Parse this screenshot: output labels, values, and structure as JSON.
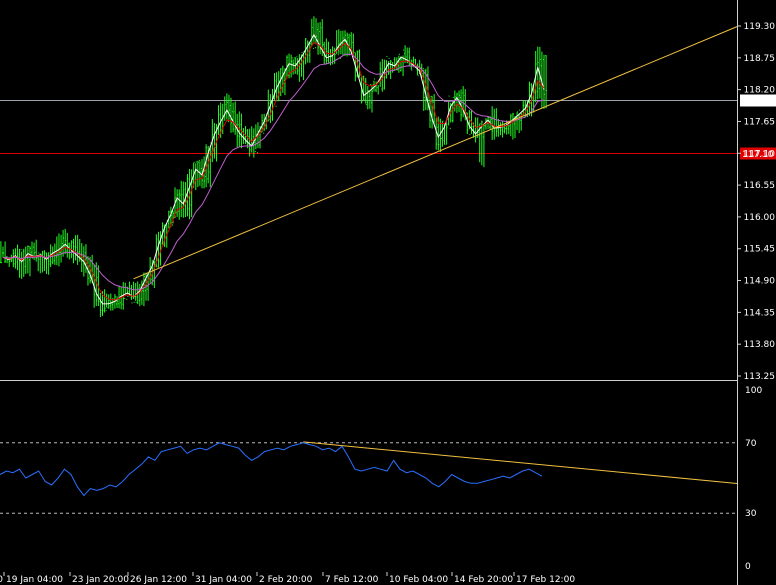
{
  "chart_data": [
    {
      "type": "candlestick",
      "symbol": "",
      "y_ticks": [
        "119.30",
        "118.75",
        "118.20",
        "117.65",
        "117.10",
        "116.55",
        "116.00",
        "115.45",
        "114.90",
        "114.35",
        "113.80",
        "113.25"
      ],
      "ylim": [
        113.25,
        119.3
      ],
      "x_ticks": [
        "19 Jan 04:00",
        "23 Jan 20:00",
        "26 Jan 12:00",
        "31 Jan 04:00",
        "2 Feb 20:00",
        "7 Feb 12:00",
        "10 Feb 04:00",
        "14 Feb 20:00",
        "17 Feb 12:00"
      ],
      "x_left_cut_label": "0",
      "price": {
        "close": [
          115.3,
          115.25,
          115.35,
          115.2,
          115.4,
          115.3,
          115.35,
          115.25,
          115.4,
          115.45,
          115.55,
          115.4,
          115.3,
          115.2,
          114.95,
          114.6,
          114.45,
          114.5,
          114.55,
          114.65,
          114.7,
          114.6,
          114.75,
          115.0,
          115.2,
          115.6,
          115.9,
          116.1,
          116.4,
          116.2,
          116.6,
          116.9,
          116.7,
          117.2,
          117.5,
          117.7,
          117.9,
          117.6,
          117.4,
          117.3,
          117.2,
          117.5,
          117.7,
          118.0,
          118.3,
          118.5,
          118.7,
          118.6,
          118.8,
          119.0,
          119.2,
          118.9,
          118.7,
          118.8,
          119.0,
          119.1,
          118.8,
          118.4,
          118.0,
          118.2,
          118.3,
          118.5,
          118.7,
          118.6,
          118.8,
          118.7,
          118.6,
          118.5,
          118.0,
          117.6,
          117.3,
          117.6,
          118.0,
          118.1,
          117.8,
          117.5,
          117.4,
          117.6,
          117.7,
          117.5,
          117.55,
          117.6,
          117.7,
          117.8,
          117.9,
          118.2,
          118.7,
          118.1
        ],
        "high_points": [
          119.5,
          118.9,
          116.8
        ],
        "low_points": [
          114.25,
          116.8
        ]
      },
      "moving_averages": [
        {
          "color": "#e00000",
          "kind": "fast"
        },
        {
          "color": "#c060d0",
          "kind": "slow"
        }
      ],
      "horizontal_lines": [
        {
          "value": 118.02,
          "color": "#9aa0a6",
          "label": "118.02"
        },
        {
          "value": 117.1,
          "color": "#e00000",
          "label": "117.10"
        }
      ],
      "trendline": {
        "color": "#f0c040",
        "points": [
          [
            21,
            114.93
          ],
          [
            86,
            117.85
          ]
        ]
      }
    },
    {
      "type": "line",
      "indicator": "oscillator",
      "y_ticks": [
        "100",
        "70",
        "30",
        "0"
      ],
      "ylim": [
        0,
        100
      ],
      "levels": [
        70,
        30
      ],
      "series": [
        {
          "color": "#2a6fff",
          "values": [
            52,
            54,
            53,
            55,
            50,
            52,
            54,
            48,
            46,
            50,
            55,
            52,
            45,
            40,
            44,
            43,
            44,
            46,
            45,
            48,
            52,
            55,
            58,
            62,
            60,
            65,
            66,
            67,
            68,
            64,
            66,
            67,
            66,
            68,
            70,
            69,
            68,
            67,
            63,
            60,
            62,
            65,
            66,
            67,
            66,
            68,
            69,
            70,
            69,
            68,
            66,
            67,
            65,
            68,
            62,
            55,
            54,
            55,
            56,
            55,
            54,
            60,
            55,
            53,
            54,
            52,
            50,
            47,
            45,
            48,
            52,
            50,
            48,
            47,
            47,
            48,
            49,
            50,
            51,
            50,
            52,
            54,
            55,
            53,
            51
          ]
        }
      ],
      "trendline": {
        "color": "#f0c040",
        "points": [
          [
            47,
            70.5
          ],
          [
            118,
            47.5
          ]
        ]
      }
    }
  ]
}
